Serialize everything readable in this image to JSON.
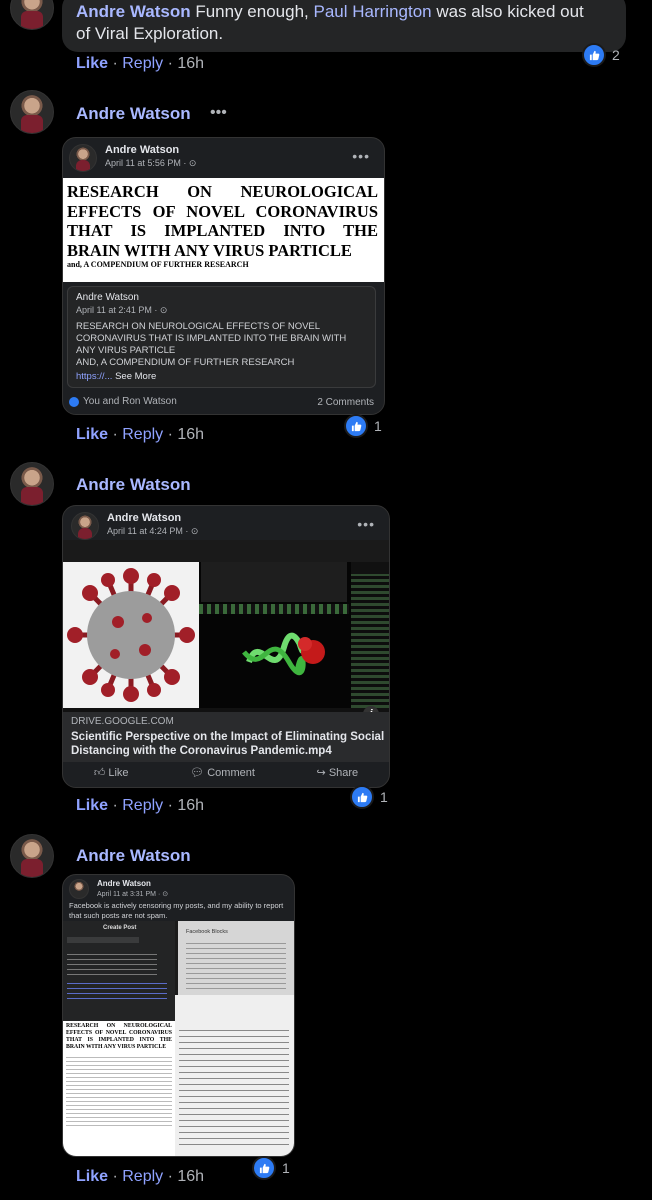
{
  "comment1": {
    "author": "Andre Watson",
    "text_a": "Funny enough,",
    "mention": "Paul Harrington",
    "text_b": "was also kicked out",
    "text_c": "of Viral Exploration.",
    "like": "Like",
    "reply": "Reply",
    "time": "16h",
    "reactions": "2"
  },
  "comment2": {
    "author": "Andre Watson",
    "more": "•••",
    "post": {
      "author": "Andre Watson",
      "date": "April 11 at 5:56 PM · ",
      "doc_title": "RESEARCH ON NEUROLOGICAL EFFECTS OF NOVEL CORONAVIRUS THAT IS IMPLANTED INTO THE BRAIN WITH ANY VIRUS PARTICLE",
      "doc_sub": "and, A COMPENDIUM OF FURTHER RESEARCH",
      "shared_author": "Andre Watson",
      "shared_date": "April 11 at 2:41 PM · ",
      "shared_line1": "RESEARCH ON NEUROLOGICAL EFFECTS OF NOVEL",
      "shared_line2": "CORONAVIRUS THAT IS IMPLANTED INTO THE BRAIN WITH",
      "shared_line3": "ANY VIRUS PARTICLE",
      "shared_line4": "AND, A COMPENDIUM OF FURTHER RESEARCH",
      "shared_link": "https://...",
      "see_more": "See More",
      "reacted": "You and Ron Watson",
      "comments": "2 Comments"
    },
    "like": "Like",
    "reply": "Reply",
    "time": "16h",
    "reactions": "1"
  },
  "comment3": {
    "author": "Andre Watson",
    "post": {
      "author": "Andre Watson",
      "date": "April 11 at 4:24 PM · ",
      "domain": "DRIVE.GOOGLE.COM",
      "title1": "Scientific Perspective on the Impact of Eliminating Social",
      "title2": "Distancing with the Coronavirus Pandemic.mp4",
      "like_btn": "Like",
      "comment_btn": "Comment",
      "share_btn": "Share"
    },
    "like": "Like",
    "reply": "Reply",
    "time": "16h",
    "reactions": "1"
  },
  "comment4": {
    "author": "Andre Watson",
    "post": {
      "author": "Andre Watson",
      "date": "April 11 at 3:31 PM · ",
      "text1": "Facebook is actively censoring my posts, and my ability to report",
      "text2": "that such posts are not spam.",
      "create_post": "Create Post",
      "fb_blocks": "Facebook Blocks",
      "doc_title": "RESEARCH ON NEUROLOGICAL EFFECTS OF NOVEL CORONAVIRUS THAT IS IMPLANTED INTO THE BRAIN WITH ANY VIRUS PARTICLE"
    },
    "like": "Like",
    "reply": "Reply",
    "time": "16h",
    "reactions": "1"
  }
}
